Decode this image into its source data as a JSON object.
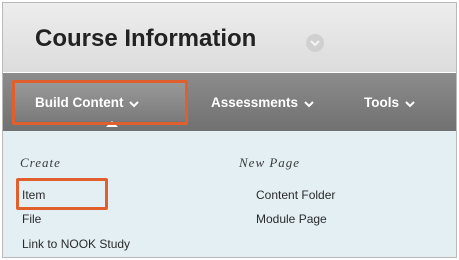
{
  "header": {
    "title": "Course Information"
  },
  "toolbar": {
    "build_content": "Build Content",
    "assessments": "Assessments",
    "tools": "Tools"
  },
  "menu": {
    "create": {
      "heading": "Create",
      "items": [
        "Item",
        "File",
        "Link to NOOK Study"
      ]
    },
    "new_page": {
      "heading": "New Page",
      "items": [
        "Content Folder",
        "Module Page"
      ]
    }
  },
  "colors": {
    "highlight": "#e15f2c",
    "toolbar": "#7d7d7d",
    "menu_background": "#e4eff4"
  }
}
